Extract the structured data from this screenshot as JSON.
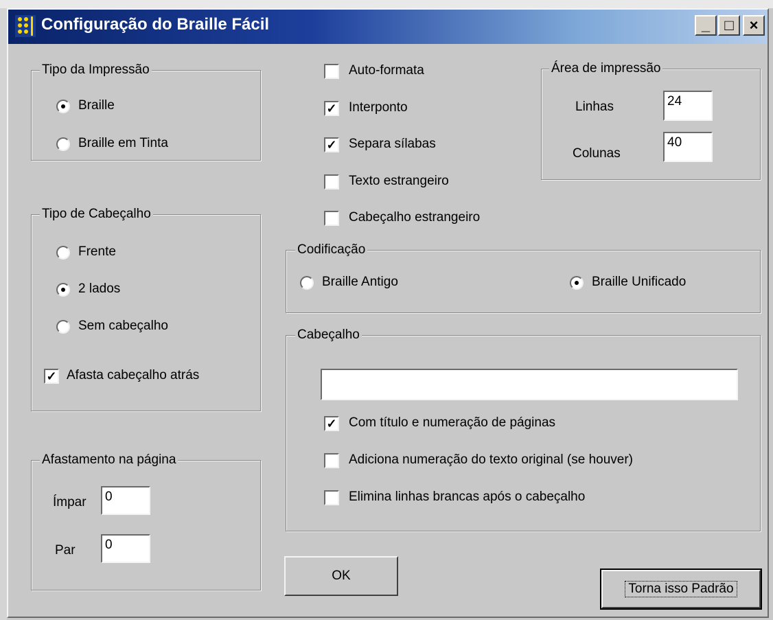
{
  "window": {
    "title": "Configuração do Braille Fácil",
    "controls": [
      "_",
      "□",
      "×"
    ]
  },
  "tipo_impressao": {
    "legend": "Tipo da Impressão",
    "options": [
      {
        "label": "Braille",
        "checked": true
      },
      {
        "label": "Braille em Tinta",
        "checked": false
      }
    ]
  },
  "tipo_cabecalho": {
    "legend": "Tipo de Cabeçalho",
    "options": [
      {
        "label": "Frente",
        "checked": false
      },
      {
        "label": "2 lados",
        "checked": true
      },
      {
        "label": "Sem cabeçalho",
        "checked": false
      }
    ],
    "afasta": {
      "label": "Afasta cabeçalho atrás",
      "checked": true
    }
  },
  "afastamento": {
    "legend": "Afastamento na  página",
    "impar_label": "Ímpar",
    "impar_value": "0",
    "par_label": "Par",
    "par_value": "0"
  },
  "options": [
    {
      "label": "Auto-formata",
      "checked": false
    },
    {
      "label": "Interponto",
      "checked": true
    },
    {
      "label": "Separa sílabas",
      "checked": true
    },
    {
      "label": "Texto estrangeiro",
      "checked": false
    },
    {
      "label": "Cabeçalho estrangeiro",
      "checked": false
    }
  ],
  "area": {
    "legend": "Área de impressão",
    "linhas_label": "Linhas",
    "linhas_value": "24",
    "colunas_label": "Colunas",
    "colunas_value": "40"
  },
  "codificacao": {
    "legend": "Codificação",
    "options": [
      {
        "label": "Braille Antigo",
        "checked": false
      },
      {
        "label": "Braille Unificado",
        "checked": true
      }
    ]
  },
  "cabecalho": {
    "legend": "Cabeçalho",
    "text_value": "",
    "options": [
      {
        "label": "Com título e numeração de páginas",
        "checked": true
      },
      {
        "label": "Adiciona numeração do texto original (se houver)",
        "checked": false
      },
      {
        "label": "Elimina linhas brancas após o cabeçalho",
        "checked": false
      }
    ]
  },
  "buttons": {
    "ok": "OK",
    "padrao": "Torna isso Padrão"
  },
  "check_mark": "✓"
}
